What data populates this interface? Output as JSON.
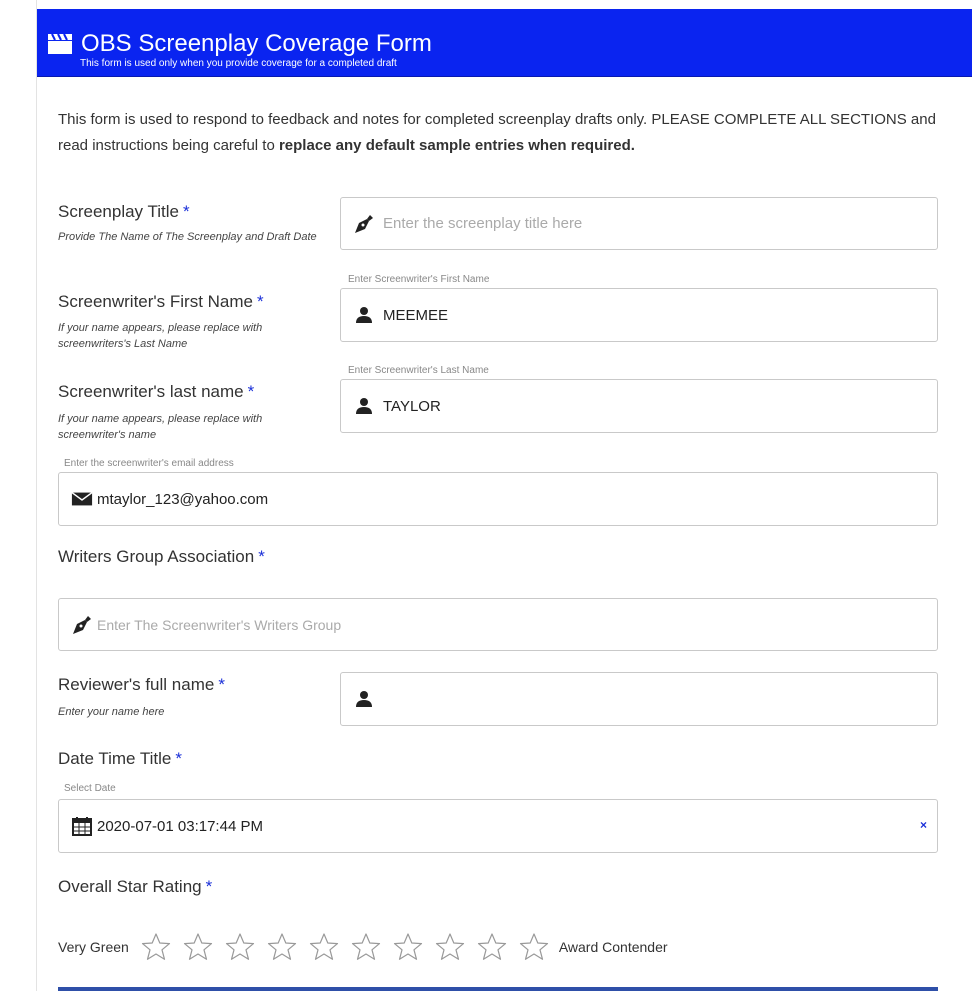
{
  "header": {
    "title": "OBS Screenplay Coverage Form",
    "subtitle": "This form is used only when you provide coverage for a completed draft",
    "icon": "clapperboard-icon",
    "background": "#0a24f0"
  },
  "intro": {
    "text": "This form is used to respond to feedback and notes for completed screenplay drafts only. PLEASE COMPLETE ALL SECTIONS and read instructions being careful to ",
    "bold": "replace any default sample entries when required."
  },
  "fields": {
    "title": {
      "label": "Screenplay Title",
      "required": "*",
      "help": "Provide The Name of The Screenplay and Draft Date",
      "placeholder": "Enter the screenplay title here",
      "icon": "pen-nib-icon"
    },
    "first_name": {
      "label": "Screenwriter's First Name",
      "required": "*",
      "help": "If your name appears, please replace with screenwriters's Last Name",
      "caption": "Enter Screenwriter's First Name",
      "value": "MEEMEE",
      "icon": "user-icon"
    },
    "last_name": {
      "label": "Screenwriter's last name",
      "required": "*",
      "help": "If your name appears, please replace with screenwriter's name",
      "caption": "Enter Screenwriter's Last Name",
      "value": "TAYLOR",
      "icon": "user-icon"
    },
    "email": {
      "caption": "Enter the screenwriter's email address",
      "value": "mtaylor_123@yahoo.com",
      "icon": "envelope-icon"
    },
    "group": {
      "label": "Writers Group Association",
      "required": "*",
      "placeholder": "Enter The Screenwriter's Writers Group",
      "icon": "pen-nib-icon"
    },
    "reviewer": {
      "label": "Reviewer's full name",
      "required": "*",
      "help": "Enter your name here",
      "value": "",
      "icon": "user-icon"
    },
    "date": {
      "label": "Date Time Title",
      "required": "*",
      "caption": "Select Date",
      "value": "2020-07-01 03:17:44 PM",
      "clear": "×",
      "icon": "calendar-icon"
    },
    "rating": {
      "label": "Overall Star Rating",
      "required": "*",
      "low_label": "Very Green",
      "high_label": "Award Contender",
      "max_stars": 10,
      "selected": 0
    }
  }
}
